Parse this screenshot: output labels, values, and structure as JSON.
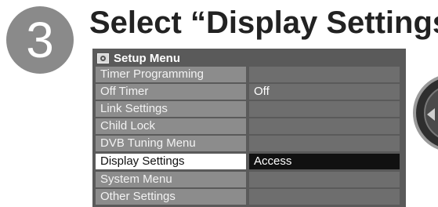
{
  "step": {
    "number": "3"
  },
  "heading": "Select “Display Settings”",
  "menu": {
    "title": "Setup Menu",
    "icon": "setup-icon",
    "items": [
      {
        "label": "Timer Programming",
        "value": "",
        "selected": false
      },
      {
        "label": "Off Timer",
        "value": "Off",
        "selected": false
      },
      {
        "label": "Link Settings",
        "value": "",
        "selected": false
      },
      {
        "label": "Child Lock",
        "value": "",
        "selected": false
      },
      {
        "label": "DVB Tuning Menu",
        "value": "",
        "selected": false
      },
      {
        "label": "Display Settings",
        "value": "Access",
        "selected": true
      },
      {
        "label": "System Menu",
        "value": "",
        "selected": false
      },
      {
        "label": "Other Settings",
        "value": "",
        "selected": false
      }
    ]
  },
  "remote": {
    "icon": "remote-dpad-icon"
  },
  "colors": {
    "menu_background": "#5a5a5a",
    "label_cell": "#8c8c8c",
    "value_cell": "#6e6e6e",
    "selected_label": "#ffffff",
    "selected_value": "#111111",
    "step_circle": "#8a8a8a"
  }
}
